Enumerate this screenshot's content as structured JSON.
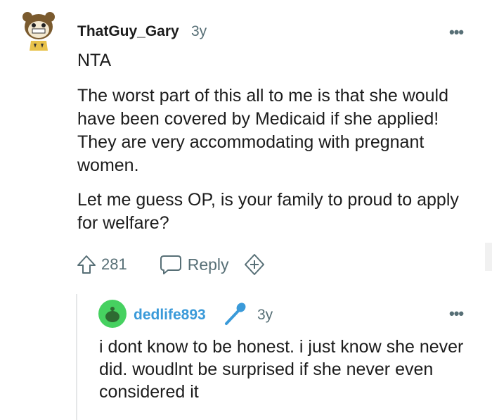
{
  "comment": {
    "username": "ThatGuy_Gary",
    "age": "3y",
    "more": "•••",
    "paragraphs": [
      "NTA",
      "The worst part of this all to me is that she would have been covered by Medicaid if she applied! They are very accommodating with pregnant women.",
      "Let me guess OP, is your family to proud to apply for welfare?"
    ],
    "score": "281",
    "reply_label": "Reply"
  },
  "reply_comment": {
    "username": "dedlife893",
    "age": "3y",
    "more": "•••",
    "text": "i dont know to be honest. i just know she never did. woudlnt be surprised if she never even considered it"
  },
  "colors": {
    "text": "#1c1c1c",
    "meta": "#576f76",
    "op_blue": "#3a9ad9",
    "avatar_green": "#46d160"
  },
  "icons": [
    "upvote-icon",
    "reply-bubble-icon",
    "award-plus-icon",
    "microphone-icon"
  ]
}
